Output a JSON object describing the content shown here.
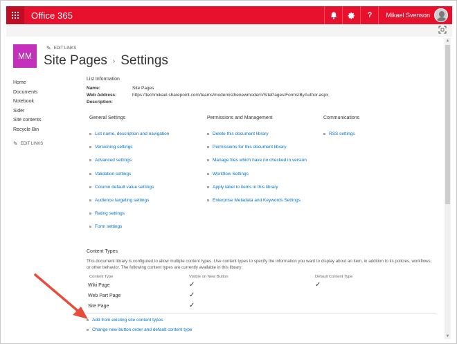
{
  "suite_bar": {
    "brand": "Office 365",
    "user_name": "Mikael Svenson",
    "help_label": "?",
    "bell_icon": "bell-icon",
    "gear_icon": "gear-icon",
    "waffle_icon": "waffle-icon",
    "accent_color": "#e8112d"
  },
  "header": {
    "logo_initials": "MM",
    "edit_links": "EDIT LINKS",
    "breadcrumb_parent": "Site Pages",
    "breadcrumb_separator": "›",
    "breadcrumb_current": "Settings"
  },
  "left_nav": {
    "items": [
      {
        "label": "Home"
      },
      {
        "label": "Documents"
      },
      {
        "label": "Notebook"
      },
      {
        "label": "Sider"
      },
      {
        "label": "Site contents"
      },
      {
        "label": "Recycle Bin"
      }
    ],
    "edit_links": "EDIT LINKS"
  },
  "list_info": {
    "heading": "List Information",
    "name_label": "Name:",
    "name_value": "Site Pages",
    "web_address_label": "Web Address:",
    "web_address_value": "https://techmikael.sharepoint.com/teams/modernisthenewmodern/SitePages/Forms/ByAuthor.aspx",
    "description_label": "Description:"
  },
  "general_settings": {
    "heading": "General Settings",
    "links": [
      {
        "label": "List name, description and navigation"
      },
      {
        "label": "Versioning settings"
      },
      {
        "label": "Advanced settings"
      },
      {
        "label": "Validation settings"
      },
      {
        "label": "Column default value settings"
      },
      {
        "label": "Audience targeting settings"
      },
      {
        "label": "Rating settings"
      },
      {
        "label": "Form settings"
      }
    ]
  },
  "permissions": {
    "heading": "Permissions and Management",
    "links": [
      {
        "label": "Delete this document library"
      },
      {
        "label": "Permissions for this document library"
      },
      {
        "label": "Manage files which have no checked in version"
      },
      {
        "label": "Workflow Settings"
      },
      {
        "label": "Apply label to items in this library"
      },
      {
        "label": "Enterprise Metadata and Keywords Settings"
      }
    ]
  },
  "communications": {
    "heading": "Communications",
    "links": [
      {
        "label": "RSS settings"
      }
    ]
  },
  "content_types": {
    "heading": "Content Types",
    "description": "This document library is configured to allow multiple content types. Use content types to specify the information you want to display about an item, in addition to its policies, workflows, or other behavior. The following content types are currently available in this library:",
    "col_content_type": "Content Type",
    "col_visible": "Visible on New Button",
    "col_default": "Default Content Type",
    "rows": [
      {
        "name": "Wiki Page",
        "visible": true,
        "default": true
      },
      {
        "name": "Web Part Page",
        "visible": true,
        "default": false
      },
      {
        "name": "Site Page",
        "visible": true,
        "default": false
      }
    ],
    "links": [
      {
        "label": "Add from existing site content types"
      },
      {
        "label": "Change new button order and default content type"
      }
    ]
  },
  "annotation": {
    "arrow_color": "#e74c3c"
  }
}
